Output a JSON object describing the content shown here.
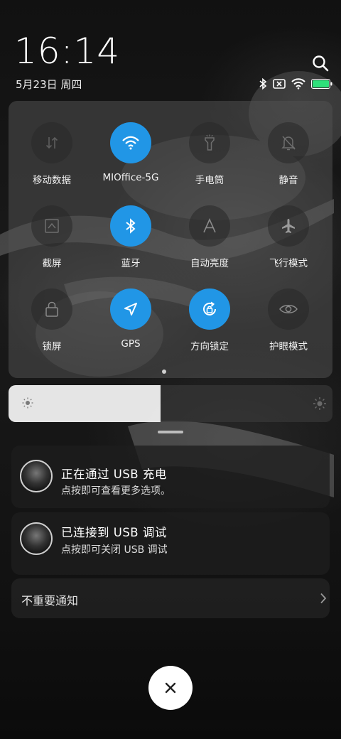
{
  "header": {
    "time": "16:14",
    "date": "5月23日 周四"
  },
  "status_icons": [
    "bluetooth-icon",
    "sim-off-icon",
    "wifi-icon",
    "battery-icon"
  ],
  "colors": {
    "accent": "#2196e6",
    "battery": "#2ee07a"
  },
  "quick_settings": [
    {
      "label": "移动数据",
      "icon": "mobile-data-icon",
      "active": false
    },
    {
      "label": "MIOffice-5G",
      "icon": "wifi-icon",
      "active": true
    },
    {
      "label": "手电筒",
      "icon": "flashlight-icon",
      "active": false
    },
    {
      "label": "静音",
      "icon": "mute-bell-icon",
      "active": false
    },
    {
      "label": "截屏",
      "icon": "screenshot-icon",
      "active": false
    },
    {
      "label": "蓝牙",
      "icon": "bluetooth-icon",
      "active": true
    },
    {
      "label": "自动亮度",
      "icon": "auto-brightness-icon",
      "active": false
    },
    {
      "label": "飞行模式",
      "icon": "airplane-icon",
      "active": false
    },
    {
      "label": "锁屏",
      "icon": "lock-icon",
      "active": false
    },
    {
      "label": "GPS",
      "icon": "location-arrow-icon",
      "active": true
    },
    {
      "label": "方向锁定",
      "icon": "rotation-lock-icon",
      "active": true
    },
    {
      "label": "护眼模式",
      "icon": "eye-icon",
      "active": false
    }
  ],
  "brightness": {
    "level": 0.47
  },
  "notifications": [
    {
      "title": "正在通过 USB 充电",
      "subtitle": "点按即可查看更多选项。"
    },
    {
      "title": "已连接到 USB 调试",
      "subtitle": "点按即可关闭 USB 调试"
    }
  ],
  "minor_notifications": {
    "label": "不重要通知"
  },
  "close_button": {
    "icon": "close-icon"
  }
}
